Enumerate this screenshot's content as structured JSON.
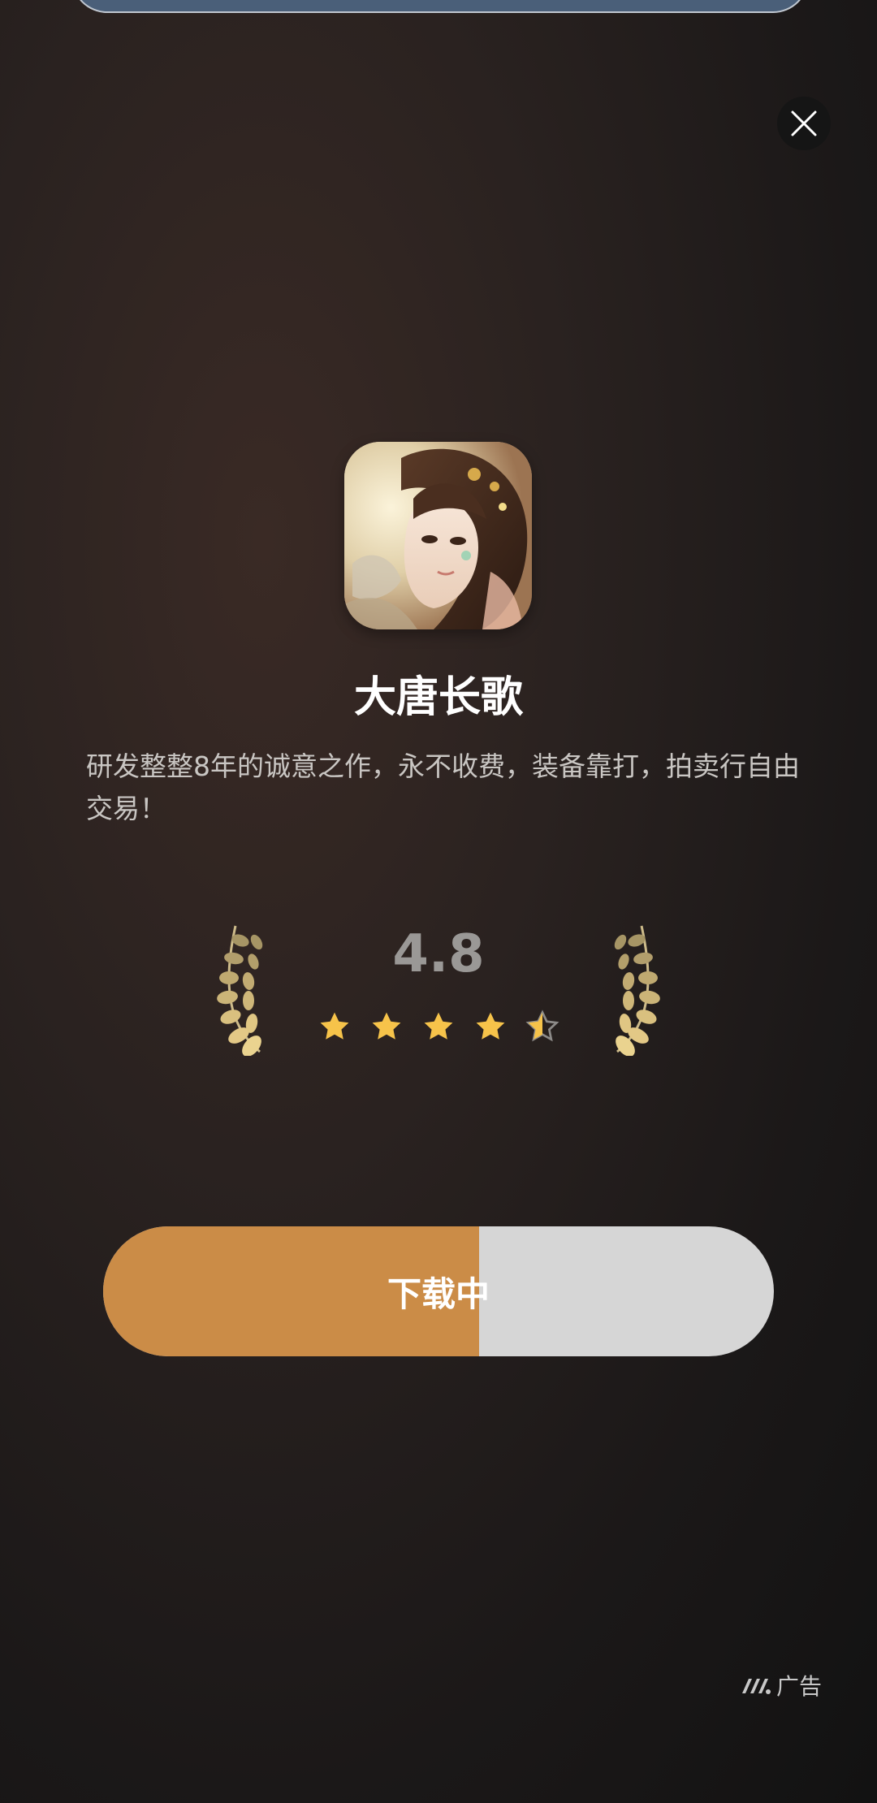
{
  "app": {
    "title": "大唐长歌",
    "description": "研发整整8年的诚意之作，永不收费，装备靠打，拍卖行自由交易！"
  },
  "rating": {
    "value": "4.8",
    "stars": 4.5,
    "max_stars": 5
  },
  "download": {
    "label": "下载中",
    "progress": 0.56
  },
  "ad": {
    "label": "广告"
  },
  "icons": {
    "close": "close-icon",
    "star": "star-icon",
    "laurel": "laurel-icon",
    "ad_logo": "ad-logo-icon"
  },
  "colors": {
    "download_fill": "#cb8c47",
    "download_track": "#d6d6d6",
    "star": "#f6c34a",
    "laurel": "#cdbb8a"
  }
}
